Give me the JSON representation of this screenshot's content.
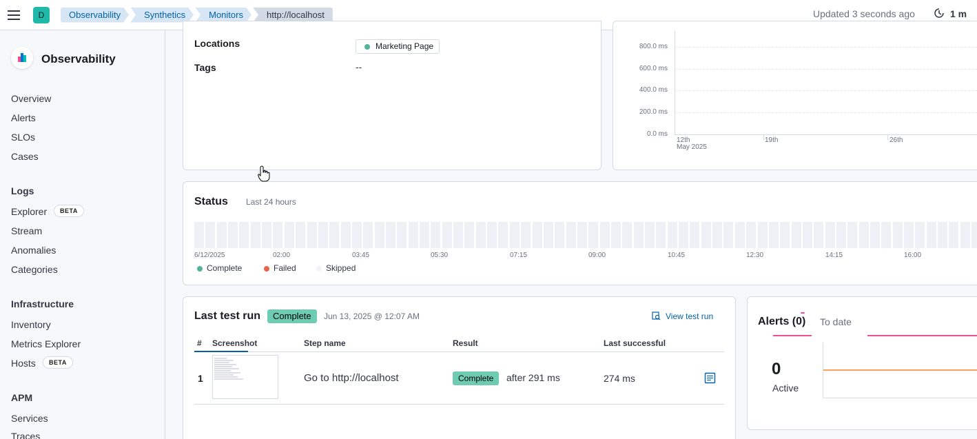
{
  "header": {
    "space_initial": "D",
    "breadcrumbs": [
      "Observability",
      "Synthetics",
      "Monitors",
      "http://localhost"
    ],
    "updated_text": "Updated 3 seconds ago",
    "refresh_interval": "1 m"
  },
  "sidebar": {
    "title": "Observability",
    "items": [
      "Overview",
      "Alerts",
      "SLOs",
      "Cases"
    ],
    "groups": [
      {
        "label": "Logs",
        "items": [
          {
            "label": "Explorer",
            "badge": "BETA"
          },
          {
            "label": "Stream"
          },
          {
            "label": "Anomalies"
          },
          {
            "label": "Categories"
          }
        ]
      },
      {
        "label": "Infrastructure",
        "items": [
          {
            "label": "Inventory"
          },
          {
            "label": "Metrics Explorer"
          },
          {
            "label": "Hosts",
            "badge": "BETA"
          }
        ]
      },
      {
        "label": "APM",
        "items": [
          {
            "label": "Services"
          },
          {
            "label": "Traces"
          }
        ]
      }
    ]
  },
  "details": {
    "locations_label": "Locations",
    "location_value": "Marketing Page",
    "tags_label": "Tags",
    "tags_value": "--"
  },
  "duration_chart": {
    "y_ticks": [
      "800.0 ms",
      "600.0 ms",
      "400.0 ms",
      "200.0 ms",
      "0.0 ms"
    ],
    "x_ticks": [
      "12th",
      "19th",
      "26th"
    ],
    "x_sub": "May 2025"
  },
  "status": {
    "title": "Status",
    "subtitle": "Last 24 hours",
    "time_labels": [
      "6/12/2025",
      "02:00",
      "03:45",
      "05:30",
      "07:15",
      "09:00",
      "10:45",
      "12:30",
      "14:15",
      "16:00"
    ],
    "legend": [
      {
        "label": "Complete",
        "color": "#54b399"
      },
      {
        "label": "Failed",
        "color": "#e7664c"
      },
      {
        "label": "Skipped",
        "color": "#f1f4fa"
      }
    ]
  },
  "last_run": {
    "title": "Last test run",
    "status_badge": "Complete",
    "date": "Jun 13, 2025 @ 12:07 AM",
    "view_link": "View test run",
    "columns": [
      "#",
      "Screenshot",
      "Step name",
      "Result",
      "Last successful"
    ],
    "rows": [
      {
        "num": "1",
        "step": "Go to http://localhost",
        "result": "Complete",
        "result_detail": "after 291 ms",
        "last_successful": "274 ms"
      }
    ]
  },
  "alerts": {
    "tab_alerts": "Alerts (0)",
    "tab_to_date": "To date",
    "active_count": "0",
    "active_label": "Active"
  },
  "colors": {
    "accent": "#0061a6",
    "complete": "#6dccb1",
    "space": "#20b9a9"
  }
}
